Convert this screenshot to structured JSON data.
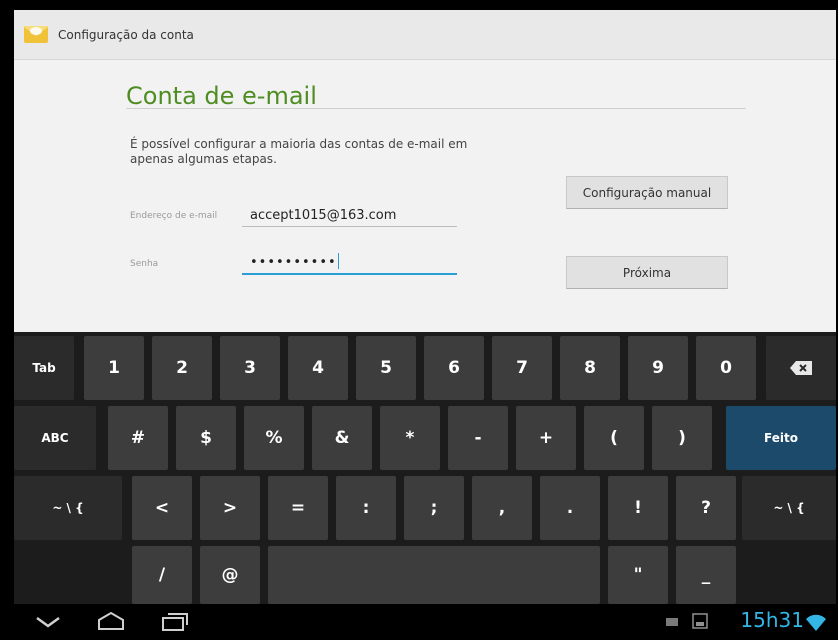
{
  "actionbar": {
    "title": "Configuração da conta",
    "icon": "email-envelope-icon"
  },
  "main": {
    "heading": "Conta de e-mail",
    "description": "É possível configurar a maioria das contas de e-mail em apenas algumas etapas.",
    "email": {
      "label": "Endereço de e-mail",
      "value": "accept1015@163.com"
    },
    "password": {
      "label": "Senha",
      "value": "••••••••••"
    },
    "manual_button": "Configuração manual",
    "next_button": "Próxima"
  },
  "keyboard": {
    "row1": [
      "Tab",
      "1",
      "2",
      "3",
      "4",
      "5",
      "6",
      "7",
      "8",
      "9",
      "0",
      "⌫"
    ],
    "row2": [
      "ABC",
      "#",
      "$",
      "%",
      "&",
      "*",
      "-",
      "+",
      "(",
      ")",
      "Feito"
    ],
    "row3": [
      "~ \\ {",
      "<",
      ">",
      "=",
      ":",
      ";",
      ",",
      ".",
      "!",
      "?",
      "~ \\ {"
    ],
    "row4": [
      "/",
      "@",
      "",
      "\"",
      "_"
    ]
  },
  "status": {
    "time": "15h31",
    "accent_color": "#33b5e5"
  }
}
